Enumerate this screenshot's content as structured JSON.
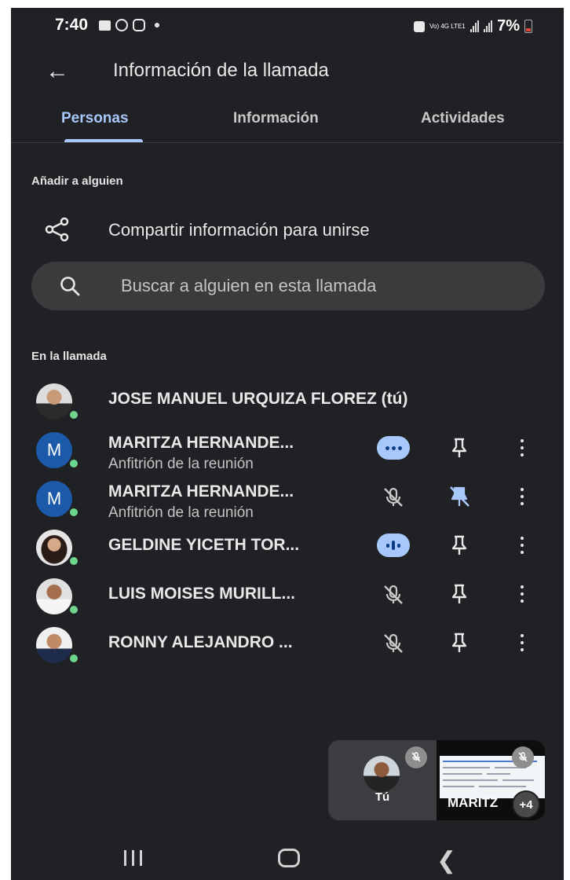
{
  "status_bar": {
    "time": "7:40",
    "network": "Vo) 4G LTE1",
    "battery_percent": "7%",
    "icons": [
      "gallery-icon",
      "whatsapp-icon",
      "instagram-icon",
      "dot-icon",
      "battery-saver-icon",
      "signal-icon",
      "battery-icon"
    ]
  },
  "app_bar": {
    "title": "Información de la llamada"
  },
  "tabs": [
    {
      "label": "Personas",
      "active": true
    },
    {
      "label": "Información",
      "active": false
    },
    {
      "label": "Actividades",
      "active": false
    }
  ],
  "add_section": {
    "header": "Añadir a alguien",
    "share_label": "Compartir información para unirse"
  },
  "search": {
    "placeholder": "Buscar a alguien en esta llamada"
  },
  "call_section": {
    "header": "En la llamada",
    "people": [
      {
        "name": "JOSE MANUEL URQUIZA FLOREZ (tú)",
        "role": "",
        "avatar": "photo"
      },
      {
        "name": "MARITZA HERNANDE...",
        "role": "Anfitrión de la reunión",
        "avatar": "M",
        "audio": "more-dots",
        "pin": "pin"
      },
      {
        "name": "MARITZA HERNANDE...",
        "role": "Anfitrión de la reunión",
        "avatar": "M",
        "audio": "muted",
        "pin": "pinned-off"
      },
      {
        "name": "GELDINE YICETH TOR...",
        "role": "",
        "avatar": "photo",
        "audio": "speaking",
        "pin": "pin"
      },
      {
        "name": "LUIS MOISES MURILL...",
        "role": "",
        "avatar": "photo",
        "audio": "muted",
        "pin": "pin"
      },
      {
        "name": "RONNY ALEJANDRO ...",
        "role": "",
        "avatar": "photo",
        "audio": "muted",
        "pin": "pin"
      }
    ]
  },
  "self_view": {
    "me_label": "Tú",
    "other_label": "MARITZ",
    "extra_count": "+4"
  },
  "colors": {
    "background": "#202124",
    "accent": "#a8c7fa",
    "online": "#6dd58c",
    "avatar_blue": "#1a5aa8"
  }
}
